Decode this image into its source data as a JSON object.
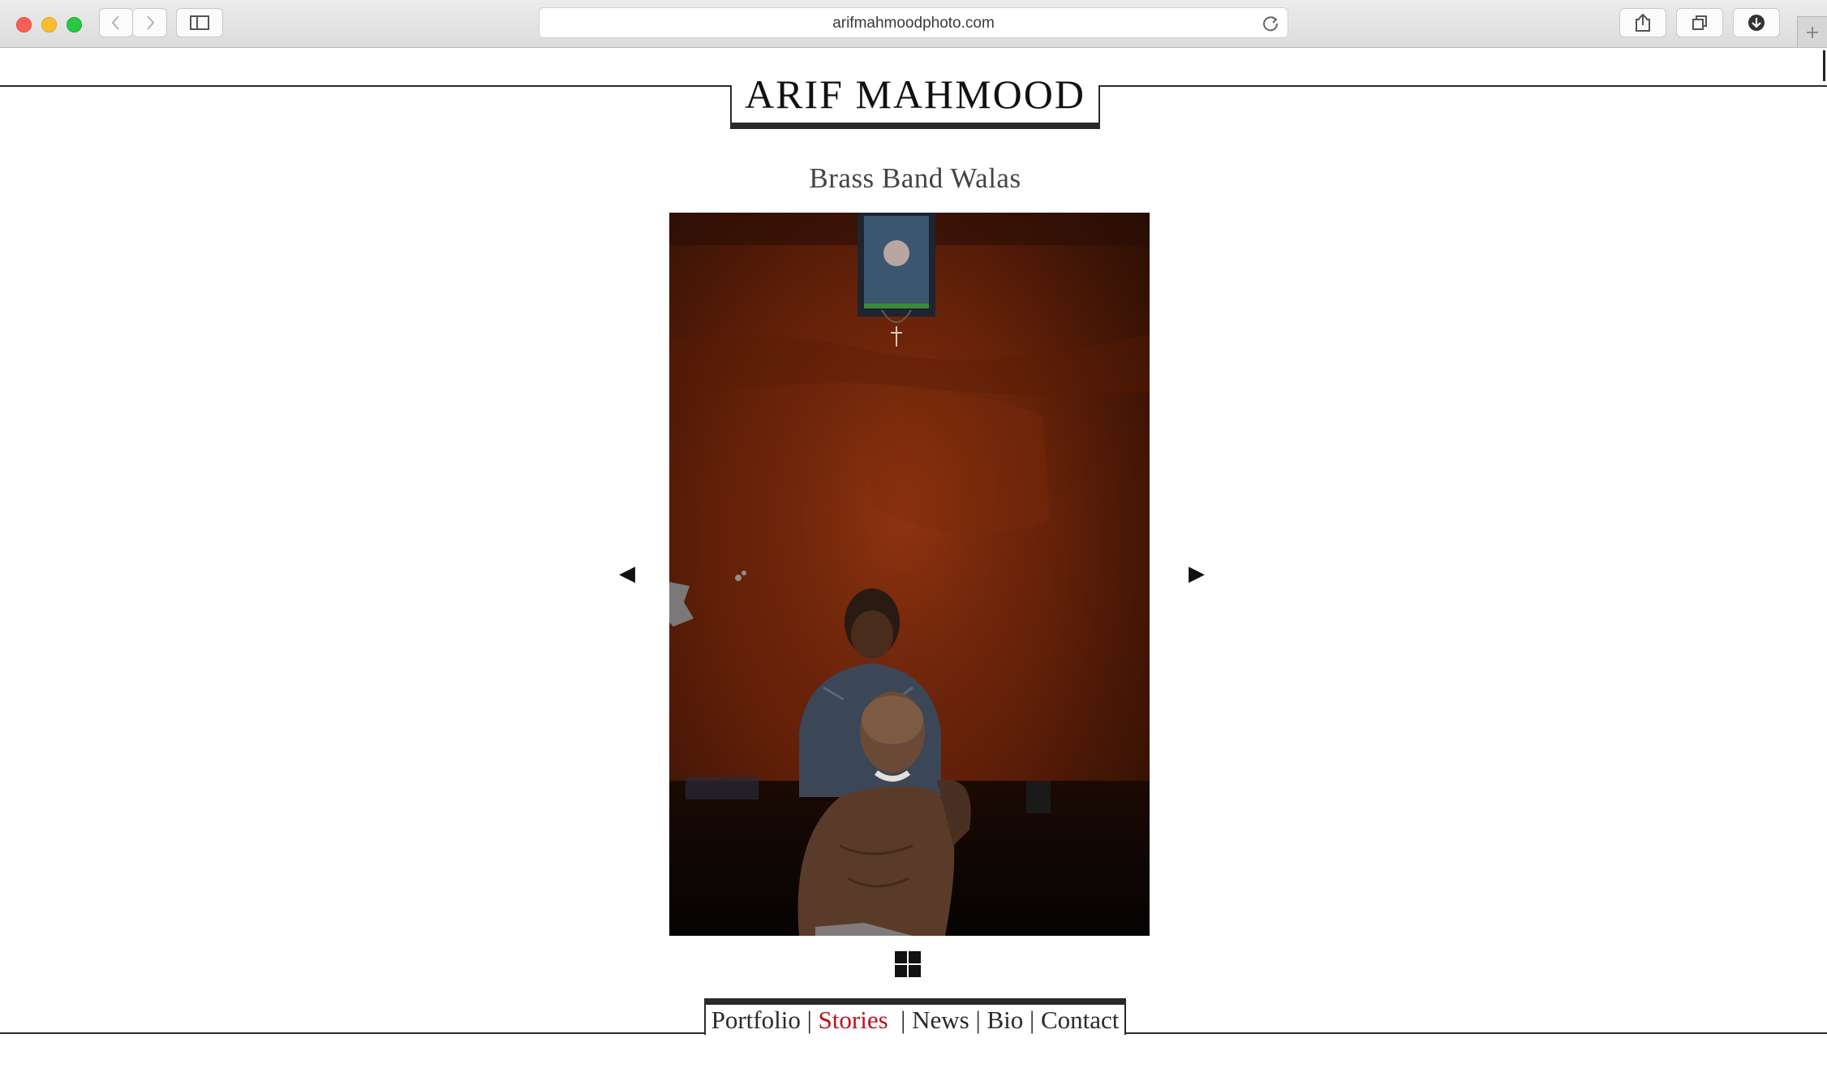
{
  "browser": {
    "url": "arifmahmoodphoto.com"
  },
  "site": {
    "title": "ARIF MAHMOOD"
  },
  "story": {
    "title": "Brass Band Walas"
  },
  "gallery": {
    "prev_symbol": "◀",
    "next_symbol": "▶"
  },
  "nav": {
    "items": [
      {
        "label": "Portfolio"
      },
      {
        "label": "Stories"
      },
      {
        "label": "News"
      },
      {
        "label": "Bio"
      },
      {
        "label": "Contact"
      }
    ],
    "separator": "|",
    "active_color": "#c0111a"
  }
}
